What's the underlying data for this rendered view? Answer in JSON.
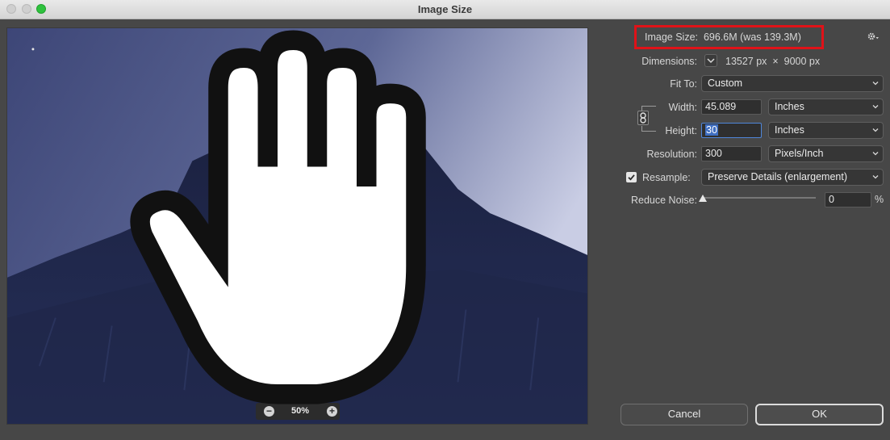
{
  "window": {
    "title": "Image Size"
  },
  "image_size": {
    "label": "Image Size:",
    "value": "696.6M (was 139.3M)"
  },
  "dimensions": {
    "label": "Dimensions:",
    "width_px": "13527 px",
    "times": "×",
    "height_px": "9000 px"
  },
  "fit_to": {
    "label": "Fit To:",
    "value": "Custom"
  },
  "width": {
    "label": "Width:",
    "value": "45.089",
    "unit": "Inches"
  },
  "height": {
    "label": "Height:",
    "value": "30",
    "unit": "Inches"
  },
  "resolution": {
    "label": "Resolution:",
    "value": "300",
    "unit": "Pixels/Inch"
  },
  "resample": {
    "label": "Resample:",
    "checked": true,
    "value": "Preserve Details (enlargement)"
  },
  "reduce_noise": {
    "label": "Reduce Noise:",
    "value": "0",
    "unit": "%",
    "level": 0
  },
  "preview": {
    "zoom": "50%",
    "zoom_out": "−",
    "zoom_in": "+"
  },
  "buttons": {
    "cancel": "Cancel",
    "ok": "OK"
  },
  "colors": {
    "highlight_border": "#e01218",
    "panel_bg": "#474747",
    "selection": "#3f6fc2"
  }
}
